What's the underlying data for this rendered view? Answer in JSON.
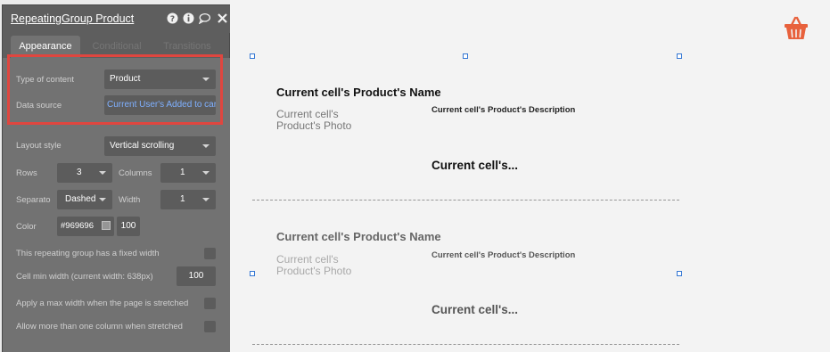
{
  "panel": {
    "title": "RepeatingGroup Product",
    "header_icons": [
      "help-icon",
      "info-icon",
      "comment-icon",
      "close-icon"
    ],
    "tabs": [
      {
        "label": "Appearance",
        "active": true
      },
      {
        "label": "Conditional",
        "active": false
      },
      {
        "label": "Transitions",
        "active": false
      }
    ],
    "type_of_content": {
      "label": "Type of content",
      "value": "Product"
    },
    "data_source": {
      "label": "Data source",
      "value": "Current User's Added to cart"
    },
    "layout_style": {
      "label": "Layout style",
      "value": "Vertical scrolling"
    },
    "rows": {
      "label": "Rows",
      "value": "3"
    },
    "columns": {
      "label": "Columns",
      "value": "1"
    },
    "separator": {
      "label": "Separato",
      "value": "Dashed"
    },
    "width": {
      "label": "Width",
      "value": "1"
    },
    "color": {
      "label": "Color",
      "hex": "#969696",
      "opacity": "100"
    },
    "fixed_width": {
      "label": "This repeating group has a fixed width",
      "checked": false
    },
    "cell_min_width": {
      "label": "Cell min width (current width: 638px)",
      "value": "100"
    },
    "max_width_stretched": {
      "label": "Apply a max width when the page is stretched",
      "checked": false
    },
    "multi_column_stretched": {
      "label": "Allow more than one column when stretched",
      "checked": false
    },
    "highlight_color": "#e0463f"
  },
  "canvas": {
    "cart_icon": "shopping-basket-icon",
    "accent_color": "#e8613c",
    "cells": [
      {
        "name": "Current cell's Product's Name",
        "photo": "Current cell's Product's Photo",
        "description": "Current cell's Product's Description",
        "price": "Current cell's..."
      },
      {
        "name": "Current cell's Product's Name",
        "photo": "Current cell's Product's Photo",
        "description": "Current cell's Product's Description",
        "price": "Current cell's..."
      }
    ]
  }
}
